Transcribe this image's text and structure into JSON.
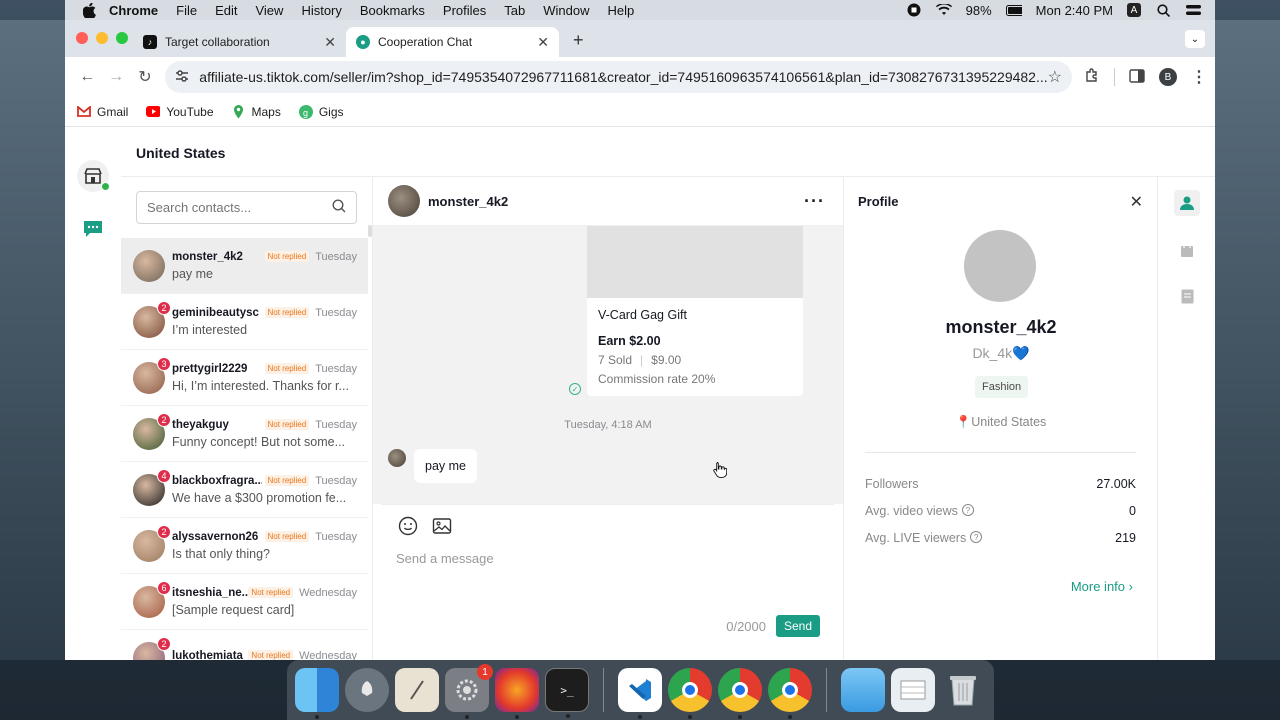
{
  "menubar": {
    "app": "Chrome",
    "items": [
      "File",
      "Edit",
      "View",
      "History",
      "Bookmarks",
      "Profiles",
      "Tab",
      "Window",
      "Help"
    ],
    "battery": "98%",
    "clock": "Mon 2:40 PM",
    "input_source": "A"
  },
  "tabs": [
    {
      "title": "Target collaboration"
    },
    {
      "title": "Cooperation Chat"
    }
  ],
  "url": "affiliate-us.tiktok.com/seller/im?shop_id=7495354072967711681&creator_id=7495160963574106561&plan_id=7308276731395229482...",
  "profile_initial": "B",
  "bookmarks": [
    "Gmail",
    "YouTube",
    "Maps",
    "Gigs"
  ],
  "region": "United States",
  "search": {
    "placeholder": "Search contacts..."
  },
  "contacts": [
    {
      "name": "monster_4k2",
      "tag": "Not replied",
      "day": "Tuesday",
      "msg": "pay me",
      "badge": "",
      "color": "#6f6356"
    },
    {
      "name": "geminibeautysc",
      "tag": "Not replied",
      "day": "Tuesday",
      "msg": "I’m interested",
      "badge": "2",
      "color": "#7a4a36"
    },
    {
      "name": "prettygirl2229",
      "tag": "Not replied",
      "day": "Tuesday",
      "msg": "Hi, I’m interested. Thanks for r...",
      "badge": "3",
      "color": "#8c5a45"
    },
    {
      "name": "theyakguy",
      "tag": "Not replied",
      "day": "Tuesday",
      "msg": "Funny concept! But not some...",
      "badge": "2",
      "color": "#3b5a2e"
    },
    {
      "name": "blackboxfragra...",
      "tag": "Not replied",
      "day": "Tuesday",
      "msg": "We have a $300 promotion fe...",
      "badge": "4",
      "color": "#1e1e1e"
    },
    {
      "name": "alyssavernon26",
      "tag": "Not replied",
      "day": "Tuesday",
      "msg": "Is that only thing?",
      "badge": "2",
      "color": "#9a7a5e"
    },
    {
      "name": "itsneshia_ne...",
      "tag": "Not replied",
      "day": "Wednesday",
      "msg": "[Sample request card]",
      "badge": "6",
      "color": "#a4573f"
    },
    {
      "name": "lukothemiata",
      "tag": "Not replied",
      "day": "Wednesday",
      "msg": "",
      "badge": "2",
      "color": "#8a5a7a"
    }
  ],
  "chat": {
    "user": "monster_4k2",
    "card": {
      "title": "V-Card Gag Gift",
      "earn": "Earn $2.00",
      "sold": "7 Sold",
      "price": "$9.00",
      "commission": "Commission rate 20%"
    },
    "timestamp": "Tuesday, 4:18 AM",
    "incoming": "pay me",
    "compose_placeholder": "Send a message",
    "counter": "0/2000",
    "send_label": "Send"
  },
  "profile": {
    "header": "Profile",
    "name": "monster_4k2",
    "handle": "Dk_4k💙",
    "category": "Fashion",
    "location": "United States",
    "stats": [
      {
        "label": "Followers",
        "value": "27.00K",
        "help": false
      },
      {
        "label": "Avg. video views",
        "value": "0",
        "help": true
      },
      {
        "label": "Avg. LIVE viewers",
        "value": "219",
        "help": true
      }
    ],
    "more_info": "More info"
  },
  "dock_badge": "1",
  "colors": {
    "accent": "#1a9c85",
    "tag": "#e8761a",
    "badge": "#e02d4b"
  }
}
